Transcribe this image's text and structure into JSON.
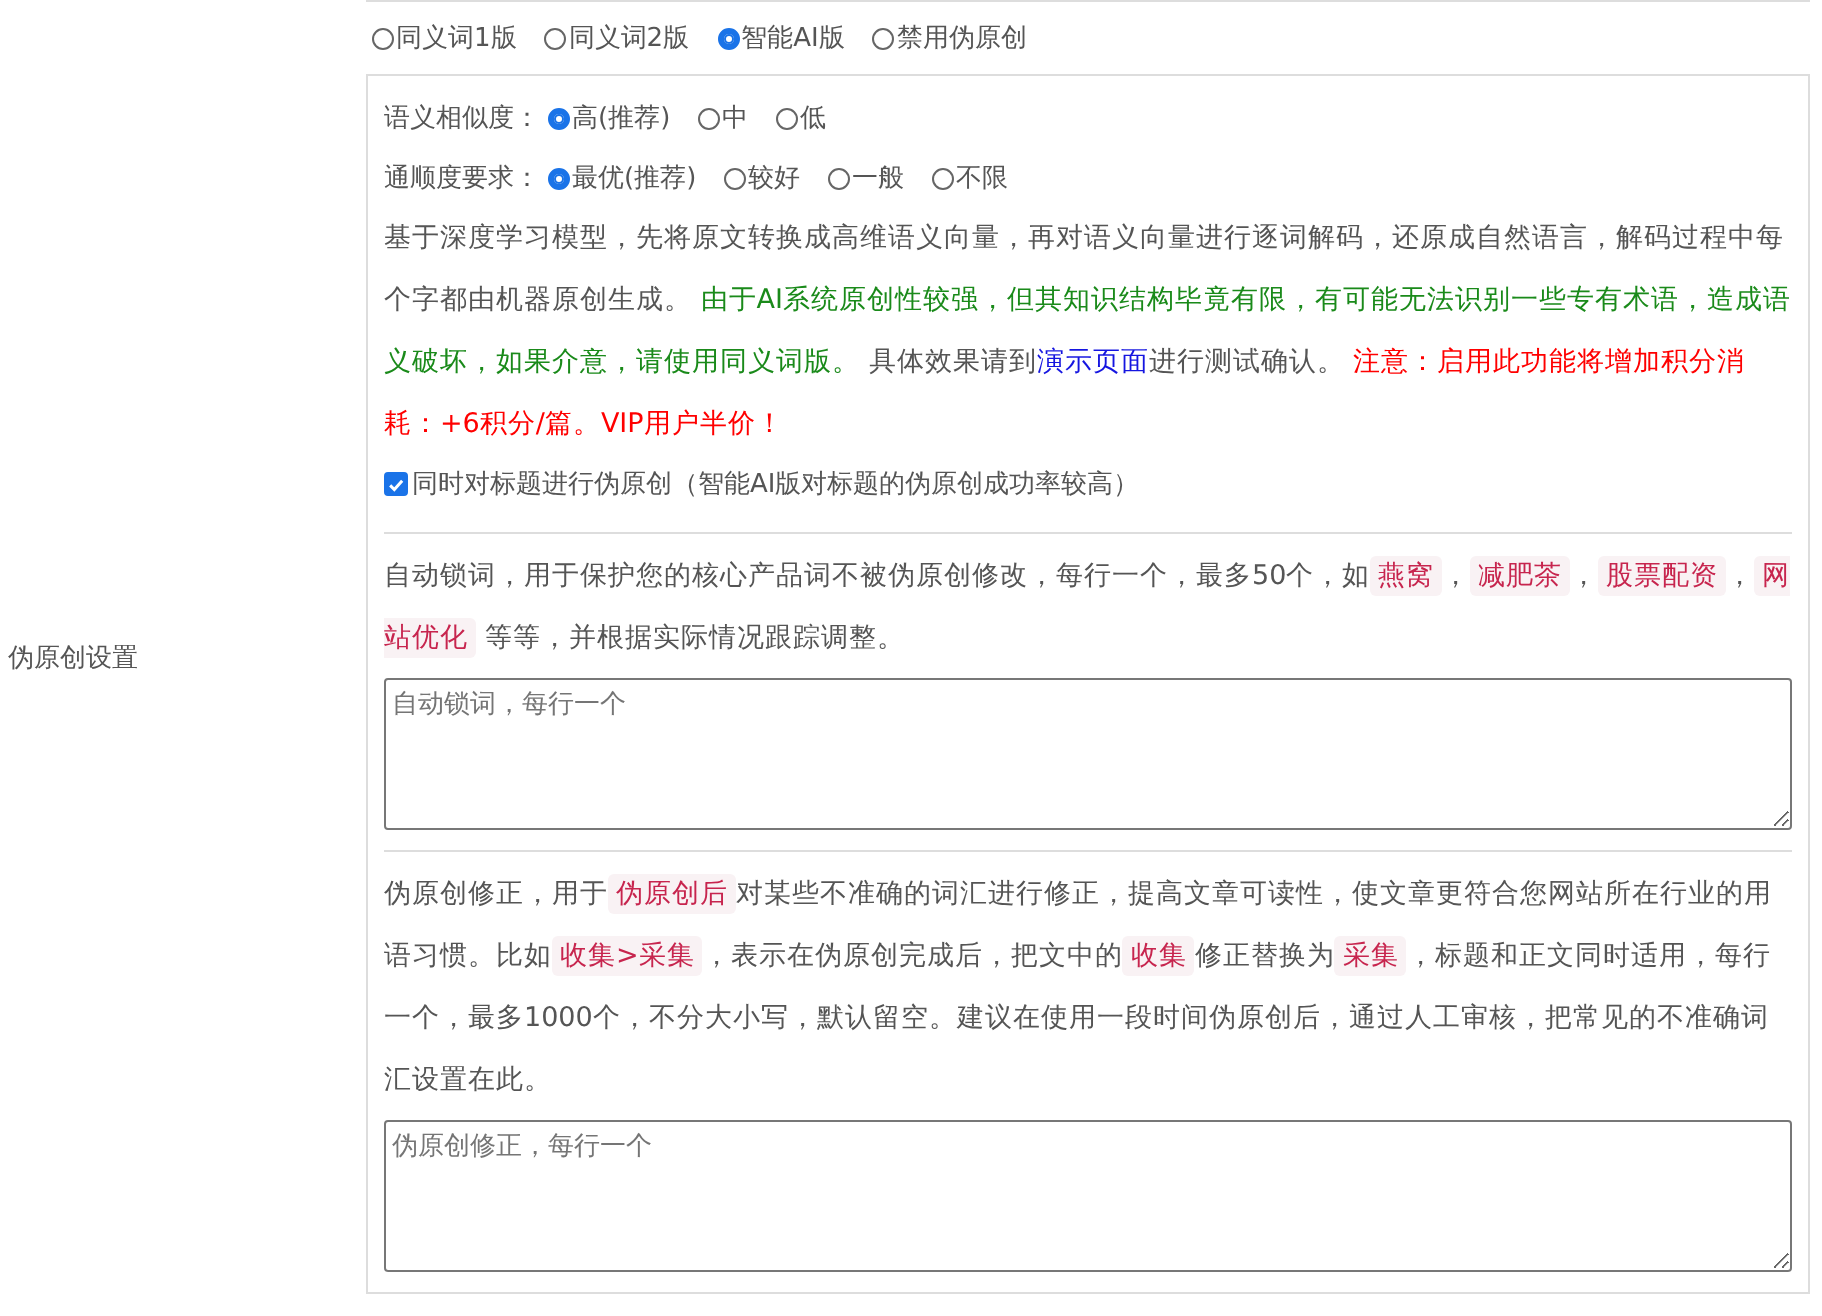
{
  "row_label": "伪原创设置",
  "modes": [
    {
      "label": "同义词1版",
      "selected": false
    },
    {
      "label": "同义词2版",
      "selected": false
    },
    {
      "label": "智能AI版",
      "selected": true
    },
    {
      "label": "禁用伪原创",
      "selected": false
    }
  ],
  "ai_panel": {
    "similarity": {
      "label": "语义相似度：",
      "options": [
        {
          "label": "高(推荐)",
          "selected": true
        },
        {
          "label": "中",
          "selected": false
        },
        {
          "label": "低",
          "selected": false
        }
      ]
    },
    "fluency": {
      "label": "通顺度要求：",
      "options": [
        {
          "label": "最优(推荐)",
          "selected": true
        },
        {
          "label": "较好",
          "selected": false
        },
        {
          "label": "一般",
          "selected": false
        },
        {
          "label": "不限",
          "selected": false
        }
      ]
    },
    "description": [
      {
        "kind": "plain",
        "text": "基于深度学习模型，先将原文转换成高维语义向量，再对语义向量进行逐词解码，还原成自然语言，解码过程中每个字都由机器原创生成。 "
      },
      {
        "kind": "green",
        "text": "由于AI系统原创性较强，但其知识结构毕竟有限，有可能无法识别一些专有术语，造成语义破坏，如果介意，请使用同义词版。"
      },
      {
        "kind": "plain",
        "text": " 具体效果请到"
      },
      {
        "kind": "link",
        "text": "演示页面"
      },
      {
        "kind": "plain",
        "text": "进行测试确认。 "
      },
      {
        "kind": "red",
        "text": "注意：启用此功能将增加积分消耗：+6积分/篇。VIP用户半价！"
      }
    ],
    "title_option": {
      "label": "同时对标题进行伪原创（智能AI版对标题的伪原创成功率较高）",
      "checked": true
    }
  },
  "lock_words": {
    "help": [
      {
        "kind": "plain",
        "text": "自动锁词，用于保护您的核心产品词不被伪原创修改，每行一个，最多50个，如"
      },
      {
        "kind": "tag",
        "text": "燕窝"
      },
      {
        "kind": "plain",
        "text": "，"
      },
      {
        "kind": "tag",
        "text": "减肥茶"
      },
      {
        "kind": "plain",
        "text": "，"
      },
      {
        "kind": "tag",
        "text": "股票配资"
      },
      {
        "kind": "plain",
        "text": "，"
      },
      {
        "kind": "tag",
        "text": "网站优化"
      },
      {
        "kind": "plain",
        "text": " 等等，并根据实际情况跟踪调整。"
      }
    ],
    "placeholder": "自动锁词，每行一个"
  },
  "corrections": {
    "help": [
      {
        "kind": "plain",
        "text": "伪原创修正，用于"
      },
      {
        "kind": "tag",
        "text": "伪原创后"
      },
      {
        "kind": "plain",
        "text": "对某些不准确的词汇进行修正，提高文章可读性，使文章更符合您网站所在行业的用语习惯。比如"
      },
      {
        "kind": "tag",
        "text": "收集>采集"
      },
      {
        "kind": "plain",
        "text": "，表示在伪原创完成后，把文中的"
      },
      {
        "kind": "tag",
        "text": "收集"
      },
      {
        "kind": "plain",
        "text": "修正替换为"
      },
      {
        "kind": "tag",
        "text": "采集"
      },
      {
        "kind": "plain",
        "text": "，标题和正文同时适用，每行一个，最多1000个，不分大小写，默认留空。建议在使用一段时间伪原创后，通过人工审核，把常见的不准确词汇设置在此。"
      }
    ],
    "placeholder": "伪原创修正，每行一个"
  }
}
